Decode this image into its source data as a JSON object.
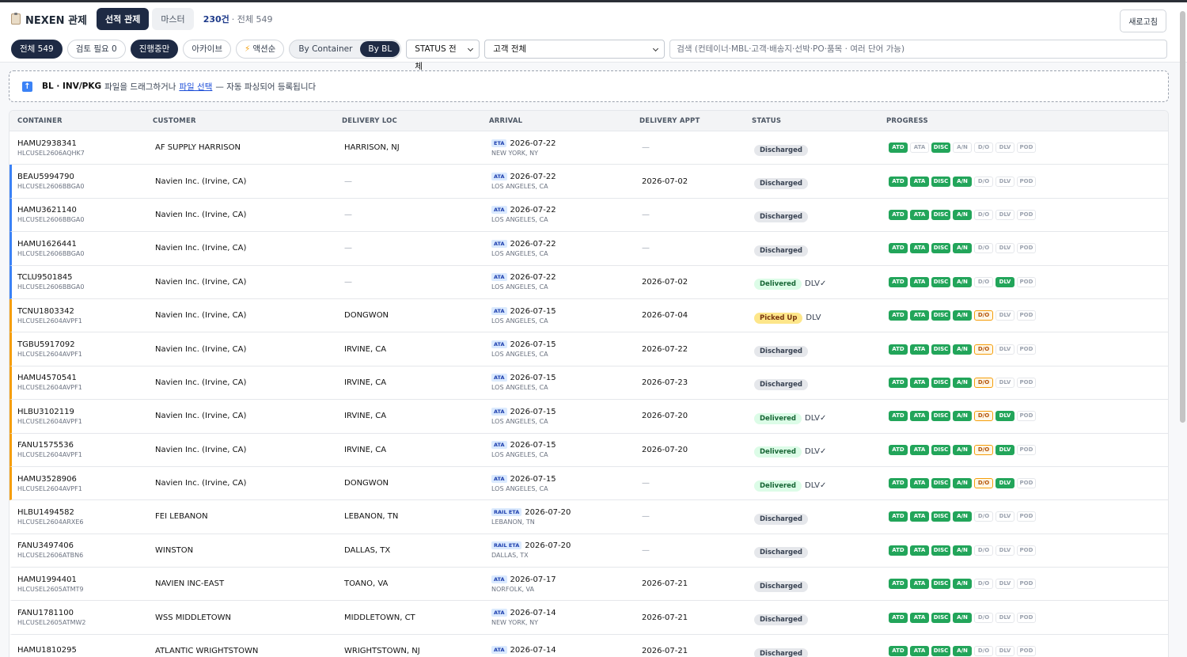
{
  "header": {
    "app_title": "NEXEN 관제",
    "tabs": [
      "선적 관제",
      "마스터"
    ],
    "count_strong": "230건",
    "count_total": "· 전체 549",
    "refresh_label": "새로고침"
  },
  "filters": {
    "all": "전체 549",
    "review": "검토 필요 0",
    "in_progress": "진행중만",
    "archive": "아카이브",
    "action": "액션순",
    "view_container": "By Container",
    "view_bl": "By BL",
    "status_select": "STATUS 전체",
    "customer_select": "고객 전체",
    "search_placeholder": "검색 (컨테이너·MBL·고객·배송지·선박·PO·품목 · 여러 단어 가능)"
  },
  "dropzone": {
    "bold": "BL · INV/PKG",
    "text1": "파일을 드래그하거나",
    "link": "파일 선택",
    "text2": "— 자동 파싱되어 등록됩니다"
  },
  "columns": [
    "CONTAINER",
    "CUSTOMER",
    "DELIVERY LOC",
    "ARRIVAL",
    "DELIVERY APPT",
    "STATUS",
    "PROGRESS"
  ],
  "step_labels": [
    "ATD",
    "ATA",
    "DISC",
    "A/N",
    "D/O",
    "DLV",
    "POD"
  ],
  "rows": [
    {
      "container": "HAMU2938341",
      "bl": "HLCUSEL2606AQHK7",
      "customer": "AF SUPPLY HARRISON",
      "loc": "HARRISON, NJ",
      "arr_tag": "ETA",
      "arr_date": "2026-07-22",
      "arr_port": "NEW YORK, NY",
      "appt": "—",
      "status": "Discharged",
      "note": "",
      "accent": "",
      "steps": [
        "g",
        "n",
        "g",
        "n",
        "n",
        "n",
        "n"
      ]
    },
    {
      "container": "BEAU5994790",
      "bl": "HLCUSEL2606BBGA0",
      "customer": "Navien Inc. (Irvine, CA)",
      "loc": "—",
      "arr_tag": "ATA",
      "arr_date": "2026-07-22",
      "arr_port": "LOS ANGELES, CA",
      "appt": "2026-07-02",
      "status": "Discharged",
      "note": "",
      "accent": "blue",
      "steps": [
        "g",
        "g",
        "g",
        "g",
        "n",
        "n",
        "n"
      ]
    },
    {
      "container": "HAMU3621140",
      "bl": "HLCUSEL2606BBGA0",
      "customer": "Navien Inc. (Irvine, CA)",
      "loc": "—",
      "arr_tag": "ATA",
      "arr_date": "2026-07-22",
      "arr_port": "LOS ANGELES, CA",
      "appt": "—",
      "status": "Discharged",
      "note": "",
      "accent": "blue",
      "steps": [
        "g",
        "g",
        "g",
        "g",
        "n",
        "n",
        "n"
      ]
    },
    {
      "container": "HAMU1626441",
      "bl": "HLCUSEL2606BBGA0",
      "customer": "Navien Inc. (Irvine, CA)",
      "loc": "—",
      "arr_tag": "ATA",
      "arr_date": "2026-07-22",
      "arr_port": "LOS ANGELES, CA",
      "appt": "—",
      "status": "Discharged",
      "note": "",
      "accent": "blue",
      "steps": [
        "g",
        "g",
        "g",
        "g",
        "n",
        "n",
        "n"
      ]
    },
    {
      "container": "TCLU9501845",
      "bl": "HLCUSEL2606BBGA0",
      "customer": "Navien Inc. (Irvine, CA)",
      "loc": "—",
      "arr_tag": "ATA",
      "arr_date": "2026-07-22",
      "arr_port": "LOS ANGELES, CA",
      "appt": "2026-07-02",
      "status": "Delivered",
      "note": "DLV✓",
      "accent": "blue",
      "steps": [
        "g",
        "g",
        "g",
        "g",
        "n",
        "g",
        "n"
      ]
    },
    {
      "container": "TCNU1803342",
      "bl": "HLCUSEL2604AVPF1",
      "customer": "Navien Inc. (Irvine, CA)",
      "loc": "DONGWON",
      "arr_tag": "ATA",
      "arr_date": "2026-07-15",
      "arr_port": "LOS ANGELES, CA",
      "appt": "2026-07-04",
      "status": "Picked Up",
      "note": "DLV",
      "accent": "orange",
      "steps": [
        "g",
        "g",
        "g",
        "g",
        "o",
        "n",
        "n"
      ]
    },
    {
      "container": "TGBU5917092",
      "bl": "HLCUSEL2604AVPF1",
      "customer": "Navien Inc. (Irvine, CA)",
      "loc": "IRVINE, CA",
      "arr_tag": "ATA",
      "arr_date": "2026-07-15",
      "arr_port": "LOS ANGELES, CA",
      "appt": "2026-07-22",
      "status": "Discharged",
      "note": "",
      "accent": "orange",
      "steps": [
        "g",
        "g",
        "g",
        "g",
        "o",
        "n",
        "n"
      ]
    },
    {
      "container": "HAMU4570541",
      "bl": "HLCUSEL2604AVPF1",
      "customer": "Navien Inc. (Irvine, CA)",
      "loc": "IRVINE, CA",
      "arr_tag": "ATA",
      "arr_date": "2026-07-15",
      "arr_port": "LOS ANGELES, CA",
      "appt": "2026-07-23",
      "status": "Discharged",
      "note": "",
      "accent": "orange",
      "steps": [
        "g",
        "g",
        "g",
        "g",
        "o",
        "n",
        "n"
      ]
    },
    {
      "container": "HLBU3102119",
      "bl": "HLCUSEL2604AVPF1",
      "customer": "Navien Inc. (Irvine, CA)",
      "loc": "IRVINE, CA",
      "arr_tag": "ATA",
      "arr_date": "2026-07-15",
      "arr_port": "LOS ANGELES, CA",
      "appt": "2026-07-20",
      "status": "Delivered",
      "note": "DLV✓",
      "accent": "orange",
      "steps": [
        "g",
        "g",
        "g",
        "g",
        "o",
        "g",
        "n"
      ]
    },
    {
      "container": "FANU1575536",
      "bl": "HLCUSEL2604AVPF1",
      "customer": "Navien Inc. (Irvine, CA)",
      "loc": "IRVINE, CA",
      "arr_tag": "ATA",
      "arr_date": "2026-07-15",
      "arr_port": "LOS ANGELES, CA",
      "appt": "2026-07-20",
      "status": "Delivered",
      "note": "DLV✓",
      "accent": "orange",
      "steps": [
        "g",
        "g",
        "g",
        "g",
        "o",
        "g",
        "n"
      ]
    },
    {
      "container": "HAMU3528906",
      "bl": "HLCUSEL2604AVPF1",
      "customer": "Navien Inc. (Irvine, CA)",
      "loc": "DONGWON",
      "arr_tag": "ATA",
      "arr_date": "2026-07-15",
      "arr_port": "LOS ANGELES, CA",
      "appt": "—",
      "status": "Delivered",
      "note": "DLV✓",
      "accent": "orange",
      "steps": [
        "g",
        "g",
        "g",
        "g",
        "o",
        "g",
        "n"
      ]
    },
    {
      "container": "HLBU1494582",
      "bl": "HLCUSEL2604ARXE6",
      "customer": "FEI LEBANON",
      "loc": "LEBANON, TN",
      "arr_tag": "RAIL ETA",
      "arr_date": "2026-07-20",
      "arr_port": "LEBANON, TN",
      "appt": "—",
      "status": "Discharged",
      "note": "",
      "accent": "",
      "steps": [
        "g",
        "g",
        "g",
        "g",
        "n",
        "n",
        "n"
      ]
    },
    {
      "container": "FANU3497406",
      "bl": "HLCUSEL2606ATBN6",
      "customer": "WINSTON",
      "loc": "DALLAS, TX",
      "arr_tag": "RAIL ETA",
      "arr_date": "2026-07-20",
      "arr_port": "DALLAS, TX",
      "appt": "—",
      "status": "Discharged",
      "note": "",
      "accent": "",
      "steps": [
        "g",
        "g",
        "g",
        "g",
        "n",
        "n",
        "n"
      ]
    },
    {
      "container": "HAMU1994401",
      "bl": "HLCUSEL2605ATMT9",
      "customer": "NAVIEN INC-EAST",
      "loc": "TOANO, VA",
      "arr_tag": "ATA",
      "arr_date": "2026-07-17",
      "arr_port": "NORFOLK, VA",
      "appt": "2026-07-21",
      "status": "Discharged",
      "note": "",
      "accent": "",
      "steps": [
        "g",
        "g",
        "g",
        "g",
        "n",
        "n",
        "n"
      ]
    },
    {
      "container": "FANU1781100",
      "bl": "HLCUSEL2605ATMW2",
      "customer": "WSS MIDDLETOWN",
      "loc": "MIDDLETOWN, CT",
      "arr_tag": "ATA",
      "arr_date": "2026-07-14",
      "arr_port": "NEW YORK, NY",
      "appt": "2026-07-21",
      "status": "Discharged",
      "note": "",
      "accent": "",
      "steps": [
        "g",
        "g",
        "g",
        "g",
        "n",
        "n",
        "n"
      ]
    },
    {
      "container": "HAMU1810295",
      "bl": "",
      "customer": "ATLANTIC WRIGHTSTOWN",
      "loc": "WRIGHTSTOWN, NJ",
      "arr_tag": "ATA",
      "arr_date": "2026-07-14",
      "arr_port": "",
      "appt": "2026-07-21",
      "status": "Discharged",
      "note": "",
      "accent": "",
      "steps": [
        "g",
        "g",
        "g",
        "g",
        "n",
        "n",
        "n"
      ]
    }
  ]
}
